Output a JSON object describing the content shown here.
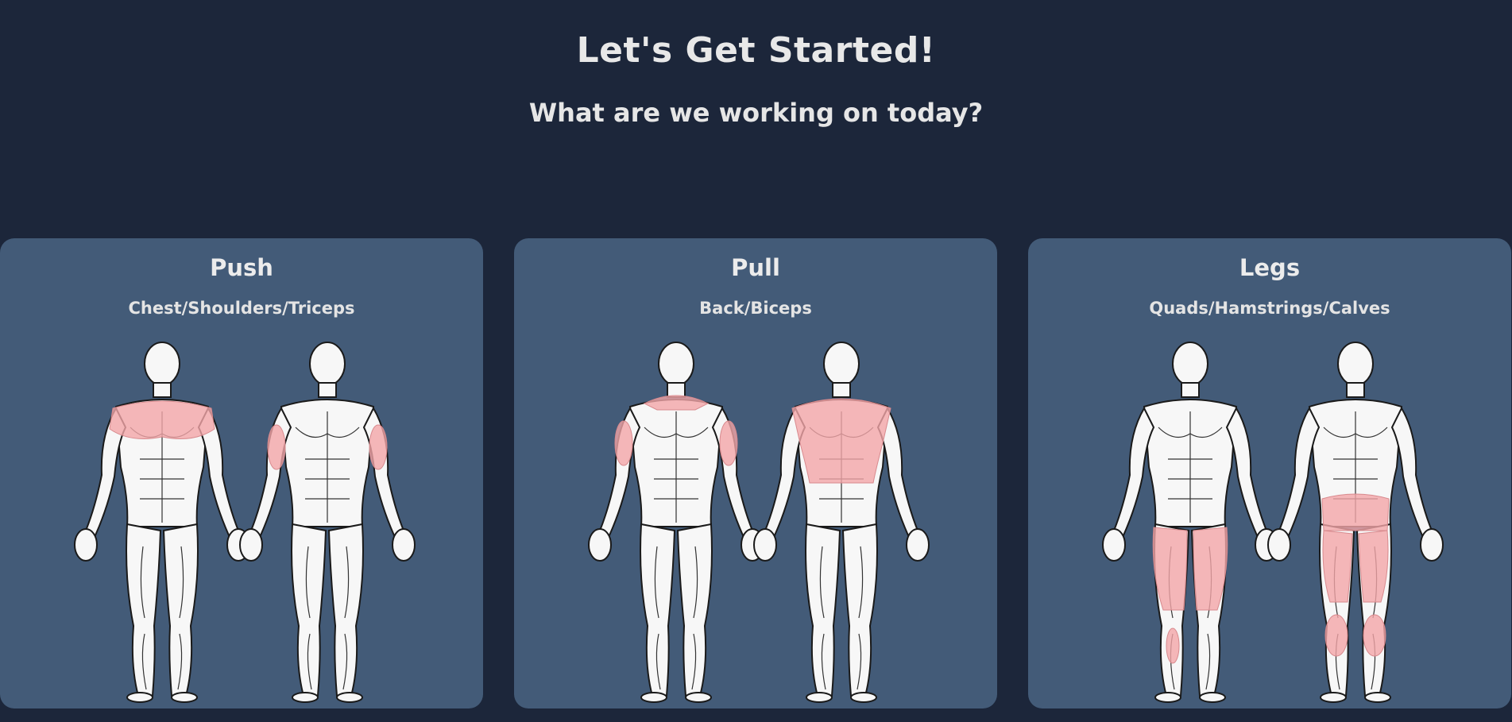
{
  "header": {
    "title": "Let's Get Started!",
    "subtitle": "What are we working on today?"
  },
  "cards": [
    {
      "title": "Push",
      "muscles": "Chest/Shoulders/Triceps",
      "highlight": [
        "chest",
        "shoulders",
        "triceps"
      ]
    },
    {
      "title": "Pull",
      "muscles": "Back/Biceps",
      "highlight": [
        "traps",
        "biceps",
        "back"
      ]
    },
    {
      "title": "Legs",
      "muscles": "Quads/Hamstrings/Calves",
      "highlight": [
        "quads",
        "hamstrings",
        "calves"
      ]
    }
  ],
  "colors": {
    "background": "#1c263a",
    "card": "#435b78",
    "highlight": "#f2a5a8",
    "text": "#e6e6e6"
  }
}
